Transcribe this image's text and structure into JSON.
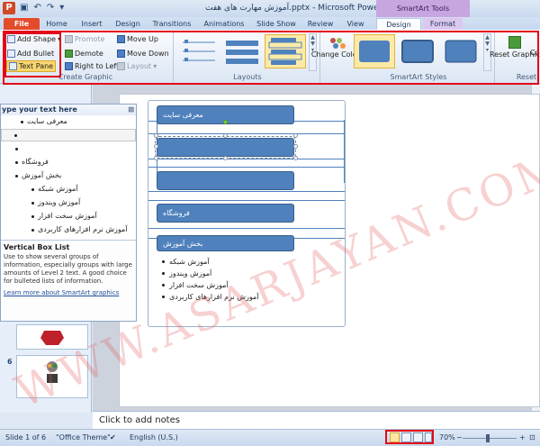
{
  "title_bar": {
    "app_icon": "P",
    "title": "آموزش مهارت های هفت.pptx - Microsoft PowerPoint",
    "context_tools": "SmartArt Tools",
    "qat_icons": [
      "save-icon",
      "undo-icon",
      "redo-icon"
    ]
  },
  "tabs": [
    {
      "label": "File"
    },
    {
      "label": "Home"
    },
    {
      "label": "Insert"
    },
    {
      "label": "Design"
    },
    {
      "label": "Transitions"
    },
    {
      "label": "Animations"
    },
    {
      "label": "Slide Show"
    },
    {
      "label": "Review"
    },
    {
      "label": "View"
    },
    {
      "label": "Design"
    },
    {
      "label": "Format"
    }
  ],
  "ribbon": {
    "create_graphic": {
      "label": "Create Graphic",
      "add_shape": "Add Shape",
      "add_bullet": "Add Bullet",
      "text_pane": "Text Pane",
      "promote": "Promote",
      "demote": "Demote",
      "right_to_left": "Right to Left",
      "layout": "Layout",
      "move_up": "Move Up",
      "move_down": "Move Down"
    },
    "layouts": {
      "label": "Layouts"
    },
    "smartart_styles": {
      "label": "SmartArt Styles",
      "change_colors": "Change Colors"
    },
    "reset": {
      "label": "Reset",
      "reset_graphic": "Reset Graphic",
      "convert": "Co"
    }
  },
  "text_pane": {
    "header": "ype your text here",
    "close": "⊠",
    "items": [
      {
        "text": "معرفی سایت",
        "bullet": false
      },
      {
        "text": "",
        "bullet": false
      },
      {
        "text": "",
        "bullet": true
      },
      {
        "text": "فروشگاه",
        "bullet": true
      },
      {
        "text": "بخش آموزش",
        "bullet": true
      },
      {
        "text": "آموزش شبکه",
        "bullet": true
      },
      {
        "text": "آموزش ویندوز",
        "bullet": true
      },
      {
        "text": "آموزش سخت افزار",
        "bullet": true
      },
      {
        "text": "آموزش نرم افزارهای کاربردی",
        "bullet": true
      }
    ],
    "desc_title": "Vertical Box List",
    "desc_body": "Use to show several groups of information, especially groups with large amounts of Level 2 text. A good choice for bulleted lists of information.",
    "desc_link": "Learn more about SmartArt graphics"
  },
  "slides": {
    "numbers": [
      "6"
    ]
  },
  "smartart": {
    "boxes": [
      {
        "text": "معرفی سایت"
      },
      {
        "text": ""
      },
      {
        "text": ""
      },
      {
        "text": "فروشگاه"
      },
      {
        "text": "بخش آموزش"
      }
    ],
    "subitems": [
      "آموزش شبکه",
      "آموزش ویندوز",
      "آموزش سخت افزار",
      "آموزش نرم افزارهای کاربردی"
    ]
  },
  "watermark": "WWW.ASARJAYAN.COM",
  "notes_placeholder": "Click to add notes",
  "status": {
    "slide": "Slide 1 of 6",
    "theme": "\"Office Theme\"",
    "language": "English (U.S.)",
    "zoom": "70%",
    "minus": "−",
    "plus": "+"
  },
  "colors": {
    "smartart_fill": "#4f81bd",
    "file_tab": "#e34b2a",
    "highlight": "#e3081a"
  }
}
